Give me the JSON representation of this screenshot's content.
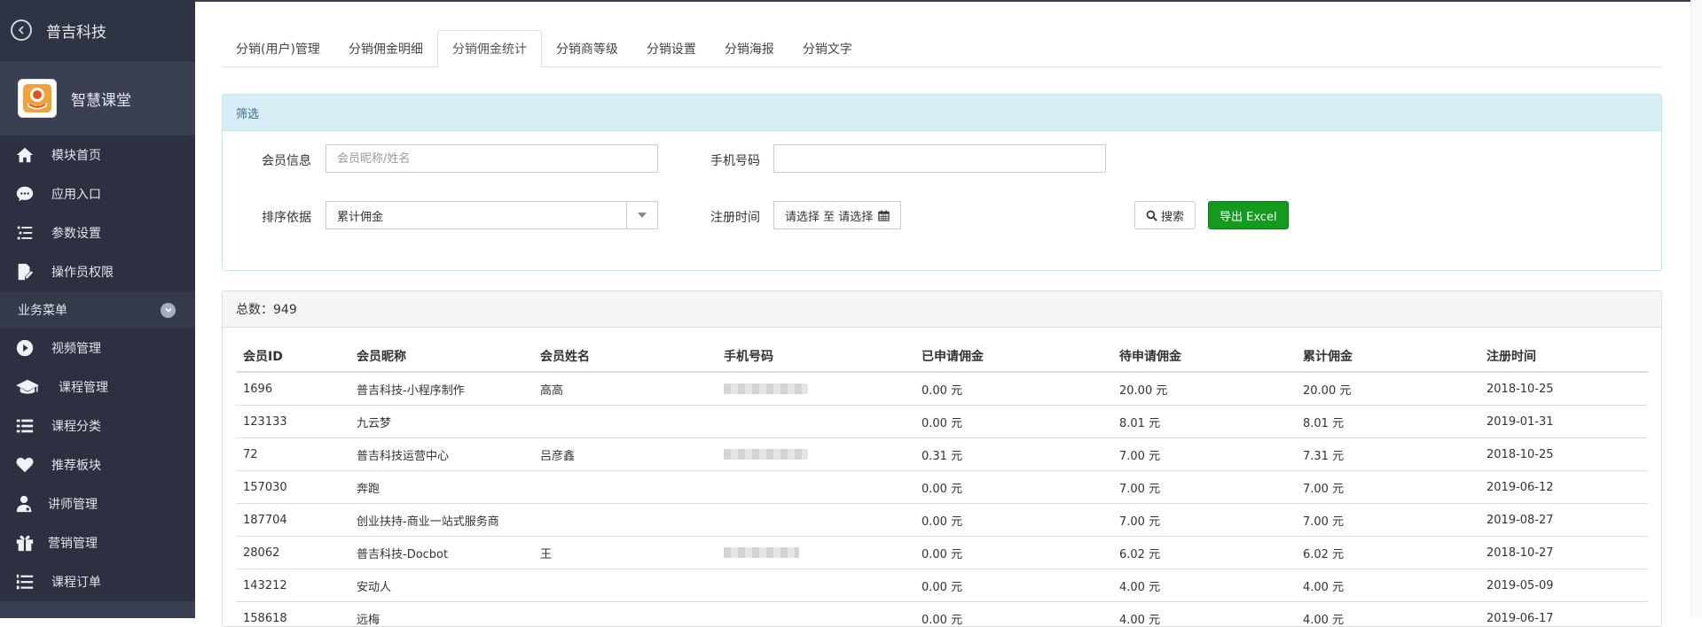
{
  "sidebar": {
    "back_title": "普吉科技",
    "app_name": "智慧课堂",
    "menu_top": [
      {
        "label": "模块首页",
        "icon": "home-icon"
      },
      {
        "label": "应用入口",
        "icon": "chat-bubble-icon"
      },
      {
        "label": "参数设置",
        "icon": "list-settings-icon"
      },
      {
        "label": "操作员权限",
        "icon": "edit-document-icon"
      }
    ],
    "group_label": "业务菜单",
    "menu_business": [
      {
        "label": "视频管理",
        "icon": "play-circle-icon"
      },
      {
        "label": "课程管理",
        "icon": "graduation-cap-icon"
      },
      {
        "label": "课程分类",
        "icon": "list-icon"
      },
      {
        "label": "推荐板块",
        "icon": "heart-icon"
      },
      {
        "label": "讲师管理",
        "icon": "user-doctor-icon"
      },
      {
        "label": "营销管理",
        "icon": "gift-icon"
      },
      {
        "label": "课程订单",
        "icon": "ordered-list-icon"
      }
    ]
  },
  "tabs": [
    {
      "label": "分销(用户)管理"
    },
    {
      "label": "分销佣金明细"
    },
    {
      "label": "分销佣金统计",
      "active": true
    },
    {
      "label": "分销商等级"
    },
    {
      "label": "分销设置"
    },
    {
      "label": "分销海报"
    },
    {
      "label": "分销文字"
    }
  ],
  "filter": {
    "title": "筛选",
    "member_label": "会员信息",
    "member_placeholder": "会员昵称/姓名",
    "phone_label": "手机号码",
    "phone_value": "",
    "sort_label": "排序依据",
    "sort_value": "累计佣金",
    "reg_label": "注册时间",
    "date_text": "请选择 至 请选择",
    "search_label": "搜索",
    "export_label": "导出 Excel"
  },
  "list": {
    "total_text": "总数：949",
    "columns": [
      "会员ID",
      "会员昵称",
      "会员姓名",
      "手机号码",
      "已申请佣金",
      "待申请佣金",
      "累计佣金",
      "注册时间"
    ],
    "rows": [
      {
        "id": "1696",
        "nick": "普吉科技-小程序制作",
        "name": "高高",
        "phone_blurred": true,
        "applied": "0.00 元",
        "pending": "20.00 元",
        "total": "20.00 元",
        "reg": "2018-10-25"
      },
      {
        "id": "123133",
        "nick": "九云梦",
        "name": "",
        "phone_blurred": false,
        "applied": "0.00 元",
        "pending": "8.01 元",
        "total": "8.01 元",
        "reg": "2019-01-31"
      },
      {
        "id": "72",
        "nick": "普吉科技运营中心",
        "name": "吕彦鑫",
        "phone_blurred": true,
        "applied": "0.31 元",
        "pending": "7.00 元",
        "total": "7.31 元",
        "reg": "2018-10-25"
      },
      {
        "id": "157030",
        "nick": "奔跑",
        "name": "",
        "phone_blurred": false,
        "applied": "0.00 元",
        "pending": "7.00 元",
        "total": "7.00 元",
        "reg": "2019-06-12"
      },
      {
        "id": "187704",
        "nick": "创业扶持-商业一站式服务商",
        "name": "",
        "phone_blurred": false,
        "applied": "0.00 元",
        "pending": "7.00 元",
        "total": "7.00 元",
        "reg": "2019-08-27"
      },
      {
        "id": "28062",
        "nick": "普吉科技-Docbot",
        "name": "王",
        "phone_blurred": true,
        "applied": "0.00 元",
        "pending": "6.02 元",
        "total": "6.02 元",
        "reg": "2018-10-27"
      },
      {
        "id": "143212",
        "nick": "安动人",
        "name": "",
        "phone_blurred": false,
        "applied": "0.00 元",
        "pending": "4.00 元",
        "total": "4.00 元",
        "reg": "2019-05-09"
      },
      {
        "id": "158618",
        "nick": "远梅",
        "name": "",
        "phone_blurred": false,
        "applied": "0.00 元",
        "pending": "4.00 元",
        "total": "4.00 元",
        "reg": "2019-06-17"
      }
    ]
  },
  "colors": {
    "sidebar_bg": "#3a3f51",
    "sidebar_menu_bg": "#2c3040",
    "filter_head_bg": "#d9edf7",
    "filter_head_text": "#31708f",
    "export_btn": "#139b1d"
  }
}
